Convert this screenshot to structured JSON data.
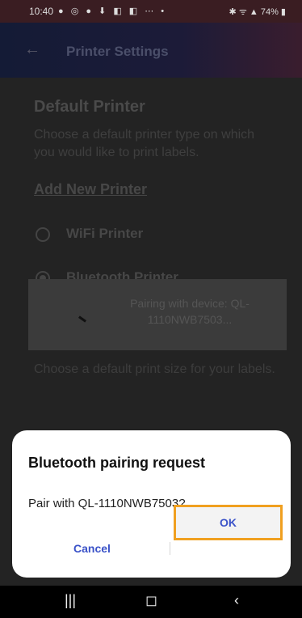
{
  "status_bar": {
    "time": "10:40",
    "notification_icons": "● ◎ ● ⬇ ◧ ◧ ⋯ •",
    "right": "✱ ᯤ ▲ 74% ▮"
  },
  "app_bar": {
    "back_icon": "←",
    "title": "Printer Settings"
  },
  "settings": {
    "default_printer_title": "Default Printer",
    "default_printer_desc": "Choose a default printer type on which you would like to print labels.",
    "add_new_printer": "Add New Printer",
    "options": [
      {
        "label": "WiFi Printer",
        "selected": false
      },
      {
        "label": "Bluetooth Printer",
        "selected": true
      }
    ],
    "size_desc": "Choose a default print size for your labels."
  },
  "toast": {
    "message": "Pairing with device: QL-1110NWB7503..."
  },
  "dialog": {
    "title": "Bluetooth pairing request",
    "message": "Pair with QL-1110NWB7503?",
    "cancel_label": "Cancel",
    "ok_label": "OK",
    "highlight_color": "#f0a020",
    "button_text_color": "#3a52c8"
  },
  "nav_bar": {
    "recents": "|||",
    "home": "◻",
    "back": "‹"
  }
}
